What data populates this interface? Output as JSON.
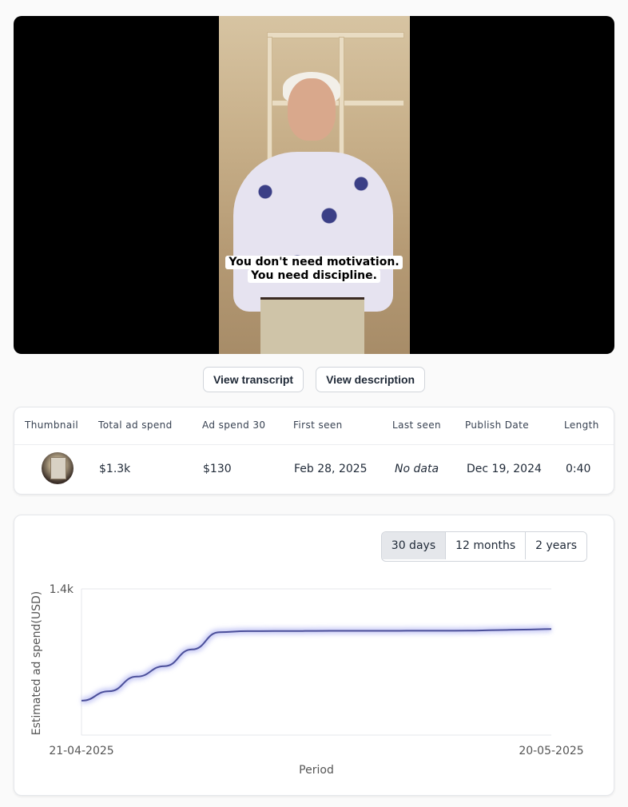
{
  "video": {
    "caption_line1": "You don't need motivation.",
    "caption_line2": "You need discipline."
  },
  "buttons": {
    "transcript": "View transcript",
    "description": "View description"
  },
  "table": {
    "headers": [
      "Thumbnail",
      "Total ad spend",
      "Ad spend 30",
      "First seen",
      "Last seen",
      "Publish Date",
      "Length"
    ],
    "row": {
      "total_ad_spend": "$1.3k",
      "ad_spend_30": "$130",
      "first_seen": "Feb 28, 2025",
      "last_seen": "No data",
      "publish_date": "Dec 19, 2024",
      "length": "0:40"
    }
  },
  "range_selector": {
    "options": [
      "30 days",
      "12 months",
      "2 years"
    ],
    "selected": "30 days"
  },
  "chart_data": {
    "type": "line",
    "x_tick_labels": [
      "21-04-2025",
      "20-05-2025"
    ],
    "ytick_label": "1.4k",
    "xlabel": "Period",
    "ylabel": "Estimated ad spend(USD)",
    "ylim": [
      0,
      1400
    ],
    "grid": true,
    "line_color": "#4b4f9a",
    "series": [
      {
        "values": [
          330,
          420,
          560,
          660,
          820,
          985,
          995,
          996,
          997,
          998,
          998,
          998,
          999,
          999,
          1000,
          1005,
          1010,
          1015
        ]
      }
    ]
  },
  "colors": {
    "accent": "#4b4f9a",
    "active_segment": "#e5e7eb"
  }
}
